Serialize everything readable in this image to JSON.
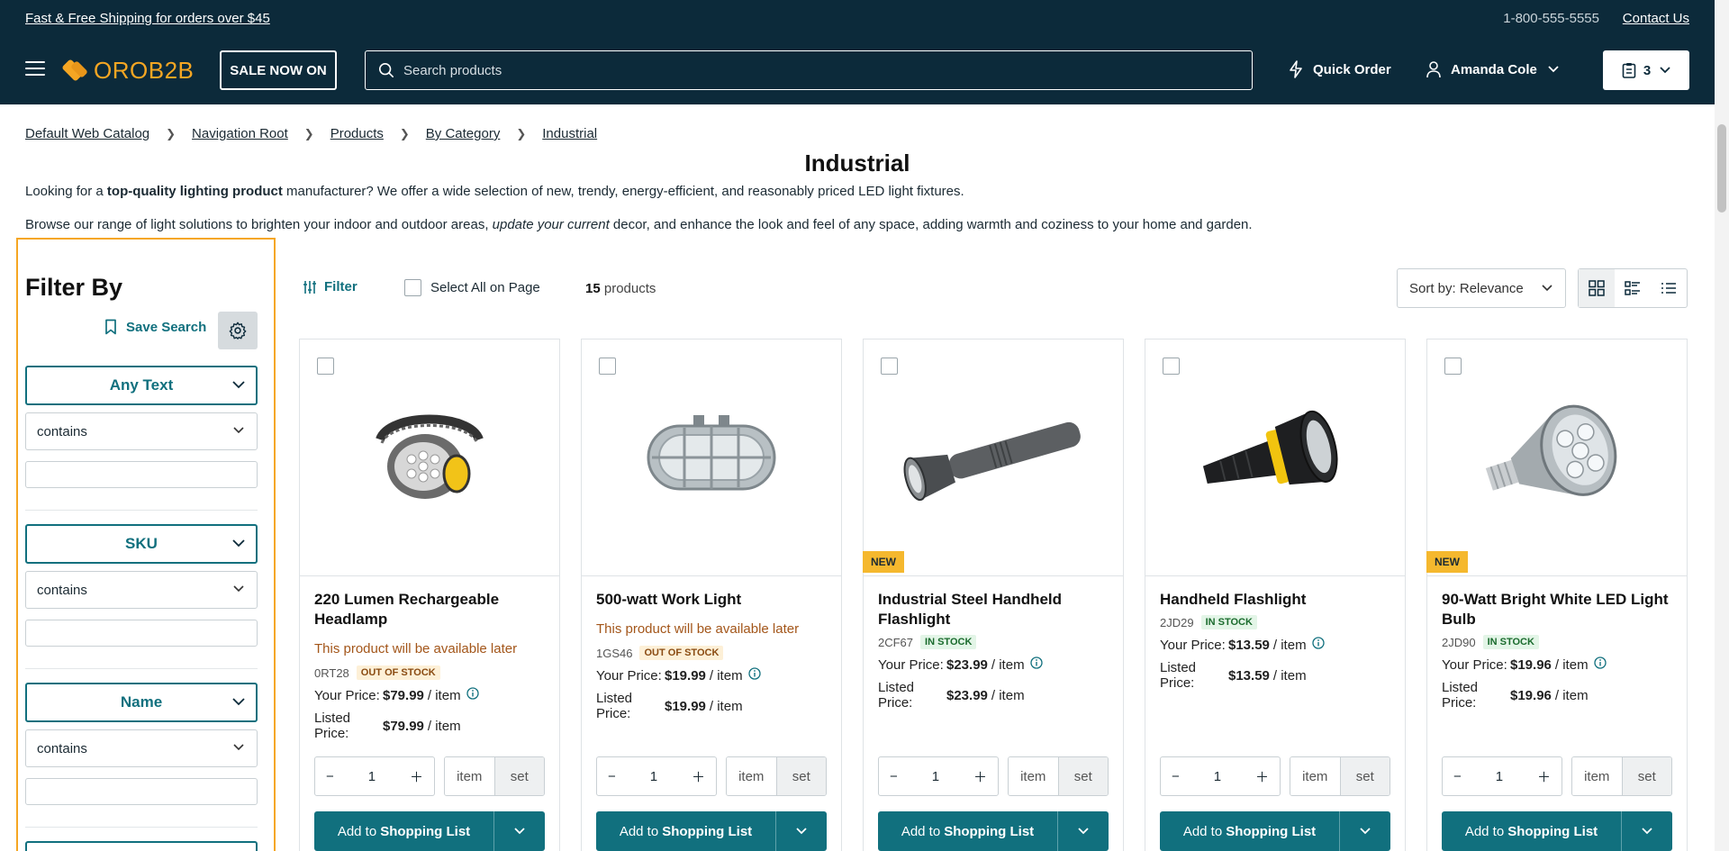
{
  "topbar": {
    "promo": "Fast & Free Shipping for orders over $45",
    "phone": "1-800-555-5555",
    "contact": "Contact Us"
  },
  "header": {
    "logo_text": "OROB2B",
    "sale_label": "SALE NOW ON",
    "search_placeholder": "Search products",
    "quick_order": "Quick Order",
    "user_name": "Amanda Cole",
    "cart_count": "3",
    "brand_color": "#0c2a3a",
    "accent_color": "#f5a623"
  },
  "breadcrumb": [
    "Default Web Catalog",
    "Navigation Root",
    "Products",
    "By Category",
    "Industrial"
  ],
  "page": {
    "title": "Industrial",
    "desc1_pre": "Looking for a ",
    "desc1_bold": "top-quality lighting product",
    "desc1_post": " manufacturer? We offer a wide selection of new, trendy, energy-efficient, and reasonably priced LED light fixtures.",
    "desc2_pre": "Browse our range of light solutions to brighten your indoor and outdoor areas, ",
    "desc2_italic": "update your current",
    "desc2_post": " decor, and enhance the look and feel of any space, adding warmth and coziness to your home and garden."
  },
  "sidebar": {
    "title": "Filter By",
    "save_search": "Save Search",
    "filters": [
      {
        "label": "Any Text",
        "operator": "contains"
      },
      {
        "label": "SKU",
        "operator": "contains"
      },
      {
        "label": "Name",
        "operator": "contains"
      }
    ]
  },
  "toolbar": {
    "filter_label": "Filter",
    "select_all": "Select All on Page",
    "count_num": "15",
    "count_label": "products",
    "sort_label": "Sort by:",
    "sort_value": "Relevance"
  },
  "labels": {
    "your_price": "Your Price:",
    "listed_price": "Listed Price:",
    "per_item": "/ item",
    "unit_item": "item",
    "unit_set": "set",
    "add_pre": "Add to",
    "add_bold": "Shopping List",
    "new_badge": "NEW"
  },
  "products": [
    {
      "name": "220 Lumen Rechargeable Headlamp",
      "availability": "This product will be available later",
      "sku": "0RT28",
      "stock": "OUT OF STOCK",
      "your_price": "$79.99",
      "listed_price": "$79.99",
      "qty": "1",
      "is_new": false
    },
    {
      "name": "500-watt Work Light",
      "availability": "This product will be available later",
      "sku": "1GS46",
      "stock": "OUT OF STOCK",
      "your_price": "$19.99",
      "listed_price": "$19.99",
      "qty": "1",
      "is_new": false
    },
    {
      "name": "Industrial Steel Handheld Flashlight",
      "availability": "",
      "sku": "2CF67",
      "stock": "IN STOCK",
      "your_price": "$23.99",
      "listed_price": "$23.99",
      "qty": "1",
      "is_new": true
    },
    {
      "name": "Handheld Flashlight",
      "availability": "",
      "sku": "2JD29",
      "stock": "IN STOCK",
      "your_price": "$13.59",
      "listed_price": "$13.59",
      "qty": "1",
      "is_new": false
    },
    {
      "name": "90-Watt Bright White LED Light Bulb",
      "availability": "",
      "sku": "2JD90",
      "stock": "IN STOCK",
      "your_price": "$19.96",
      "listed_price": "$19.96",
      "qty": "1",
      "is_new": true
    }
  ]
}
